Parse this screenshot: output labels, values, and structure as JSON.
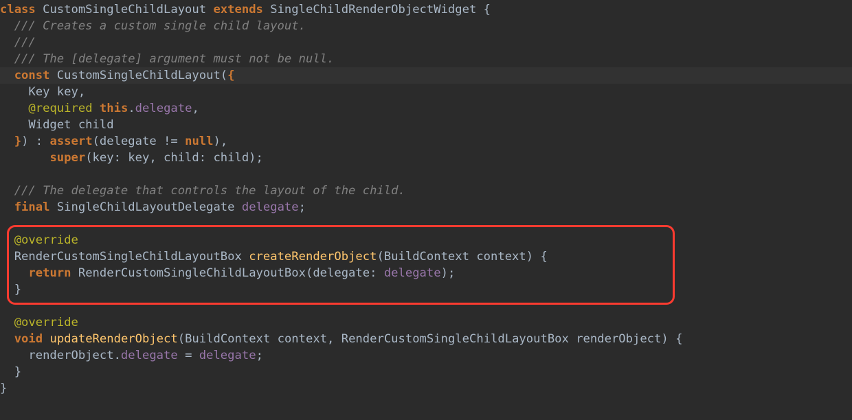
{
  "code": {
    "l1": {
      "kw_class": "class",
      "name": " CustomSingleChildLayout ",
      "kw_extends": "extends",
      "base": " SingleChildRenderObjectWidget {"
    },
    "l2": "  /// Creates a custom single child layout.",
    "l3": "  ///",
    "l4": {
      "prefix": "  /// The [",
      "ref": "delegate",
      "suffix": "] argument must not be null."
    },
    "l5": {
      "indent": "  ",
      "kw": "const",
      "name": " CustomSingleChildLayout(",
      "brace": "{"
    },
    "l6": "    Key key,",
    "l7": {
      "indent": "    ",
      "meta": "@required",
      "space": " ",
      "kw": "this",
      "dot": ".",
      "field": "delegate",
      "comma": ","
    },
    "l8": "    Widget child",
    "l9": {
      "indent": "  ",
      "brace": "}",
      "paren": ") : ",
      "assert": "assert",
      "args": "(delegate != ",
      "nul": "null",
      "close": "),"
    },
    "l10": {
      "indent": "       ",
      "sup": "super",
      "args": "(key: key, child: child);"
    },
    "l11": "",
    "l12": "  /// The delegate that controls the layout of the child.",
    "l13": {
      "indent": "  ",
      "kw": "final",
      "type": " SingleChildLayoutDelegate ",
      "field": "delegate",
      "semi": ";"
    },
    "l14": "",
    "l15": {
      "indent": "  ",
      "meta": "@override"
    },
    "l16": {
      "indent": "  ",
      "type": "RenderCustomSingleChildLayoutBox ",
      "fn": "createRenderObject",
      "args": "(BuildContext context) {"
    },
    "l17": {
      "indent": "    ",
      "kw": "return",
      "call": " RenderCustomSingleChildLayoutBox(delegate: ",
      "field": "delegate",
      "close": ");"
    },
    "l18": {
      "indent": "  ",
      "brace": "}"
    },
    "l19": "",
    "l20": {
      "indent": "  ",
      "meta": "@override"
    },
    "l21": {
      "indent": "  ",
      "kw": "void",
      "space": " ",
      "fn": "updateRenderObject",
      "args": "(BuildContext context, RenderCustomSingleChildLayoutBox renderObject) {"
    },
    "l22": {
      "indent": "    renderObject.",
      "field1": "delegate",
      "eq": " = ",
      "field2": "delegate",
      "semi": ";"
    },
    "l23": {
      "indent": "  ",
      "brace": "}"
    },
    "l24": "}"
  }
}
